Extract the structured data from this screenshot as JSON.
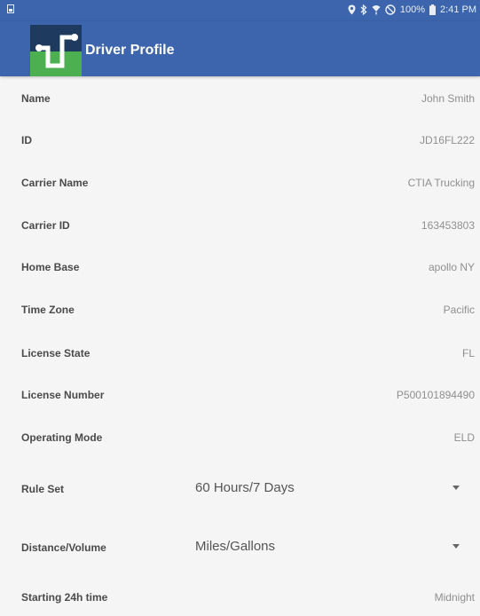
{
  "status_bar": {
    "battery": "100%",
    "time": "2:41 PM",
    "icons": [
      "notification-icon",
      "location-icon",
      "bluetooth-icon",
      "wifi-icon",
      "do-not-disturb-icon",
      "battery-icon"
    ]
  },
  "app_bar": {
    "title": "Driver Profile",
    "colors": {
      "primary": "#3c65ad",
      "logo_green": "#4caf50",
      "logo_navy": "#1f3a5f"
    }
  },
  "profile": {
    "name": {
      "label": "Name",
      "value": "John Smith"
    },
    "id": {
      "label": "ID",
      "value": "JD16FL222"
    },
    "carrier_name": {
      "label": "Carrier Name",
      "value": "CTIA Trucking"
    },
    "carrier_id": {
      "label": "Carrier ID",
      "value": "163453803"
    },
    "home_base": {
      "label": "Home Base",
      "value": "apollo NY"
    },
    "time_zone": {
      "label": "Time Zone",
      "value": "Pacific"
    },
    "license_state": {
      "label": "License State",
      "value": "FL"
    },
    "license_number": {
      "label": "License Number",
      "value": "P500101894490"
    },
    "operating_mode": {
      "label": "Operating Mode",
      "value": "ELD"
    },
    "rule_set": {
      "label": "Rule Set",
      "value": "60 Hours/7 Days"
    },
    "distance_volume": {
      "label": "Distance/Volume",
      "value": "Miles/Gallons"
    },
    "starting_time": {
      "label": "Starting 24h time",
      "value": "Midnight"
    }
  }
}
